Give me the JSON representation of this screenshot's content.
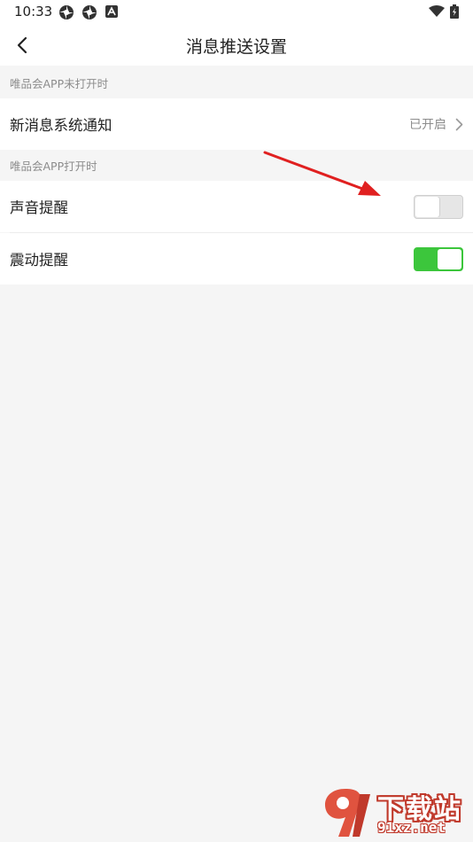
{
  "status_bar": {
    "time": "10:33",
    "left_icons": [
      "app-icon",
      "app-icon",
      "notification-icon"
    ],
    "right_icons": [
      "wifi-icon",
      "battery-icon"
    ]
  },
  "nav": {
    "title": "消息推送设置",
    "back_icon": "chevron-left-icon"
  },
  "sections": [
    {
      "header": "唯品会APP未打开时",
      "rows": [
        {
          "label": "新消息系统通知",
          "value": "已开启",
          "control": "chevron"
        }
      ]
    },
    {
      "header": "唯品会APP打开时",
      "rows": [
        {
          "label": "声音提醒",
          "control": "toggle",
          "on": false
        },
        {
          "label": "震动提醒",
          "control": "toggle",
          "on": true
        }
      ]
    }
  ],
  "colors": {
    "toggle_on": "#3cc63c",
    "toggle_off": "#e6e6e6",
    "annotation_arrow": "#e02020",
    "watermark": "#c0392b"
  },
  "watermark": {
    "title": "下载站",
    "url": "91xz.net"
  }
}
